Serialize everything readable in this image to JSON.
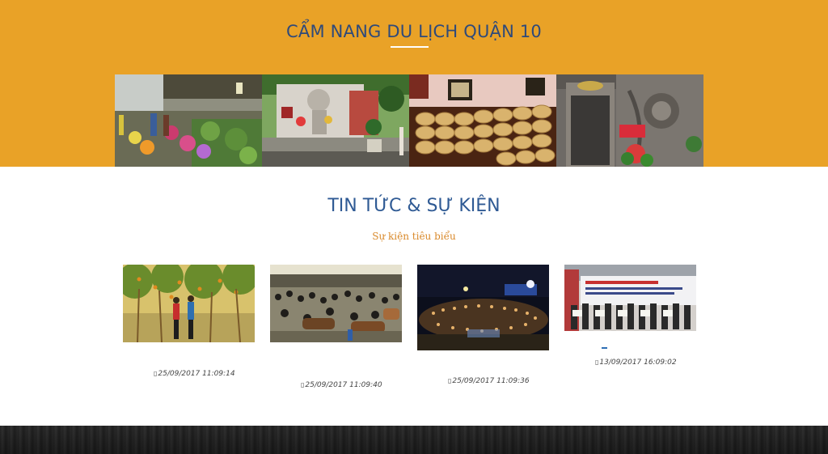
{
  "guide": {
    "title": "CẨM NANG DU LỊCH QUẬN 10",
    "tiles": [
      {
        "icon": "flower-market-photo"
      },
      {
        "icon": "monument-memorial-photo"
      },
      {
        "icon": "baskets-storehouse-photo"
      },
      {
        "icon": "relief-plaque-photo"
      }
    ]
  },
  "news": {
    "title": "TIN TỨC & SỰ KIỆN",
    "subtitle": "Sự kiện tiêu biểu",
    "items": [
      {
        "timestamp": "25/09/2017 11:09:14",
        "icon": "calendar-icon"
      },
      {
        "timestamp": "25/09/2017 11:09:40",
        "icon": "calendar-icon"
      },
      {
        "timestamp": "25/09/2017 11:09:36",
        "icon": "calendar-icon"
      },
      {
        "timestamp": "13/09/2017 16:09:02",
        "icon": "calendar-icon"
      }
    ]
  },
  "colors": {
    "guide_bg": "#e9a227",
    "title_blue": "#2f5a94",
    "subtitle_orange": "#d9892a",
    "footer_dark": "#2e2e2e"
  }
}
